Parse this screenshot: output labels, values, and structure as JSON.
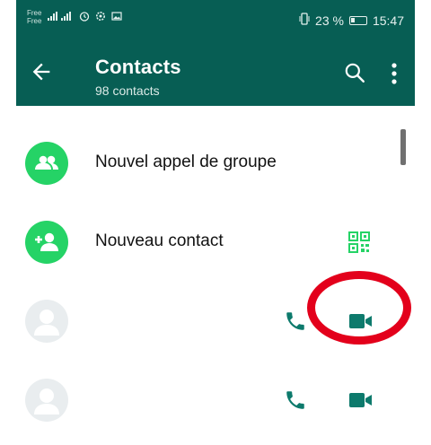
{
  "statusbar": {
    "carrier_top": "Free",
    "carrier_bottom": "Free",
    "battery_percent": "23 %",
    "time": "15:47"
  },
  "appbar": {
    "title": "Contacts",
    "subtitle": "98 contacts"
  },
  "rows": [
    {
      "label": "Nouvel appel de groupe"
    },
    {
      "label": "Nouveau contact"
    },
    {
      "label": ""
    },
    {
      "label": ""
    }
  ],
  "colors": {
    "header": "#075e54",
    "accent": "#25d366",
    "icon_green": "#0d7a6c",
    "annotation_red": "#e3001b"
  },
  "icons": {
    "back": "arrow-back-icon",
    "search": "search-icon",
    "more": "more-vert-icon",
    "group": "group-icon",
    "add_contact": "add-contact-icon",
    "qr": "qr-code-icon",
    "call": "phone-icon",
    "video": "video-call-icon",
    "avatar": "person-icon"
  }
}
